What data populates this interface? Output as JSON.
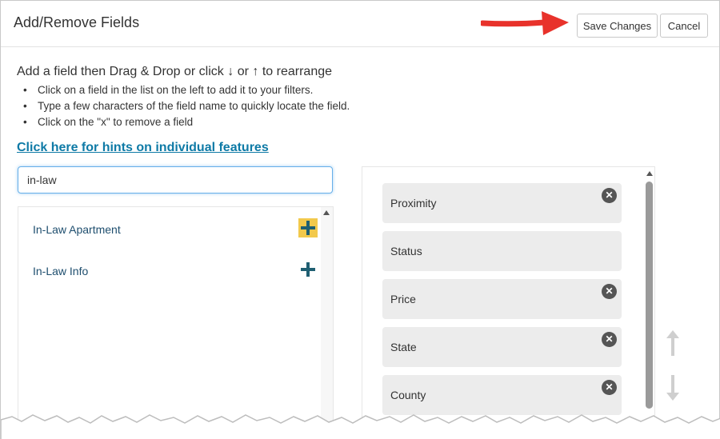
{
  "header": {
    "title": "Add/Remove Fields",
    "save_label": "Save Changes",
    "cancel_label": "Cancel"
  },
  "instructions": {
    "lead_before": "Add a field then Drag & Drop or click",
    "down_glyph": "↓",
    "middle": "or",
    "up_glyph": "↑",
    "lead_after": "to rearrange",
    "bullets": [
      "Click on a field in the list on the left to add it to your filters.",
      "Type a few characters of the field name to quickly locate the field.",
      "Click on the \"x\" to remove a field"
    ]
  },
  "hint_link": "Click here for hints on individual features",
  "search": {
    "value": "in-law"
  },
  "available_fields": [
    {
      "label": "In-Law Apartment",
      "highlighted": true
    },
    {
      "label": "In-Law Info",
      "highlighted": false
    }
  ],
  "selected_fields": [
    {
      "label": "Proximity",
      "removable": true
    },
    {
      "label": "Status",
      "removable": false
    },
    {
      "label": "Price",
      "removable": true
    },
    {
      "label": "State",
      "removable": true
    },
    {
      "label": "County",
      "removable": true
    }
  ],
  "icons": {
    "remove": "x-circle-icon",
    "add": "plus-icon",
    "callout": "red-arrow-icon",
    "move_up": "arrow-up-icon",
    "move_down": "arrow-down-icon"
  },
  "colors": {
    "link": "#0e7aa6",
    "plus": "#1f5f72",
    "plus_highlight": "#f2c94c",
    "callout_arrow": "#e8322b",
    "field_bg": "#ececec"
  }
}
